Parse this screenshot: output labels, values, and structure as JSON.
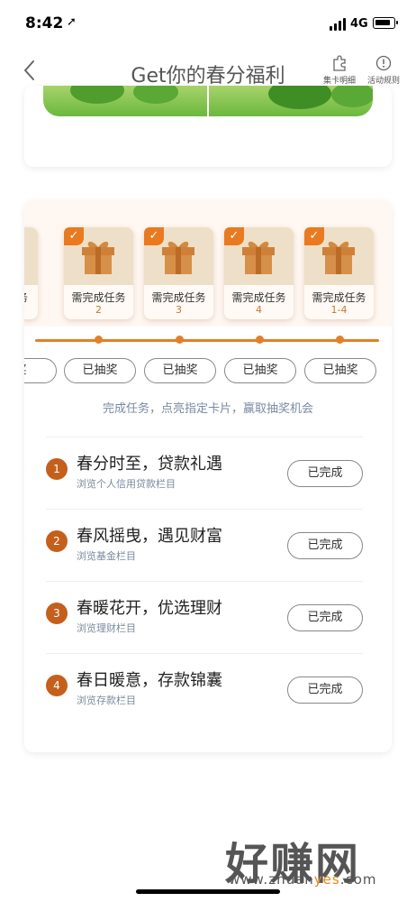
{
  "status_bar": {
    "time": "8:42",
    "location_icon": "➚",
    "network": "4G"
  },
  "nav": {
    "back_icon": "‹",
    "title": "Get你的春分福利",
    "card_detail_label": "集卡明细",
    "rules_label": "活动规则"
  },
  "colors": {
    "accent": "#e57f26",
    "badge": "#c4601c",
    "hint": "#7a8aa0"
  },
  "gift_cards": [
    {
      "label": "需完成任务",
      "num": "2",
      "checked": true
    },
    {
      "label": "需完成任务",
      "num": "3",
      "checked": true
    },
    {
      "label": "需完成任务",
      "num": "4",
      "checked": true
    },
    {
      "label": "需完成任务",
      "num": "1-4",
      "checked": true
    }
  ],
  "partial_card_label": "务",
  "draw_buttons": [
    "奖",
    "已抽奖",
    "已抽奖",
    "已抽奖",
    "已抽奖"
  ],
  "hint": "完成任务，点亮指定卡片，赢取抽奖机会",
  "tasks": [
    {
      "num": "1",
      "title": "春分时至，贷款礼遇",
      "sub": "浏览个人信用贷款栏目",
      "status": "已完成"
    },
    {
      "num": "2",
      "title": "春风摇曳，遇见财富",
      "sub": "浏览基金栏目",
      "status": "已完成"
    },
    {
      "num": "3",
      "title": "春暖花开，优选理财",
      "sub": "浏览理财栏目",
      "status": "已完成"
    },
    {
      "num": "4",
      "title": "春日暖意，存款锦囊",
      "sub": "浏览存款栏目",
      "status": "已完成"
    }
  ],
  "watermark": {
    "text": "好赚网",
    "url_a": "www.zhuan",
    "url_b": "yes",
    "url_c": ".com"
  }
}
